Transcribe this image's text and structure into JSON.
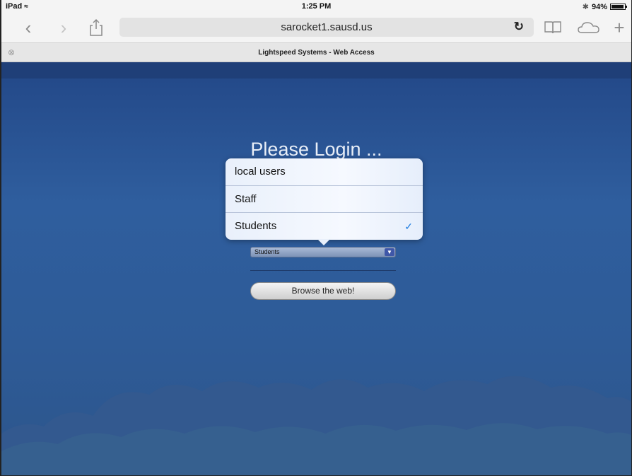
{
  "statusbar": {
    "device": "iPad",
    "time": "1:25 PM",
    "battery": "94%"
  },
  "toolbar": {
    "url": "sarocket1.sausd.us",
    "icons": [
      "back-icon",
      "forward-icon",
      "share-icon",
      "reload-icon",
      "bookmarks-icon",
      "cloud-tabs-icon",
      "new-tab-icon"
    ]
  },
  "tab": {
    "title": "Lightspeed Systems - Web Access"
  },
  "page": {
    "heading": "Please Login ...",
    "select_value": "Students",
    "browse_button": "Browse the web!"
  },
  "popover": {
    "options": [
      {
        "label": "local users",
        "selected": false
      },
      {
        "label": "Staff",
        "selected": false
      },
      {
        "label": "Students",
        "selected": true
      }
    ],
    "check_color": "#1a7ae0"
  },
  "colors": {
    "background_top": "#1f3f78",
    "background_mid": "#2f5e9e",
    "clouds": "#3a6299"
  }
}
